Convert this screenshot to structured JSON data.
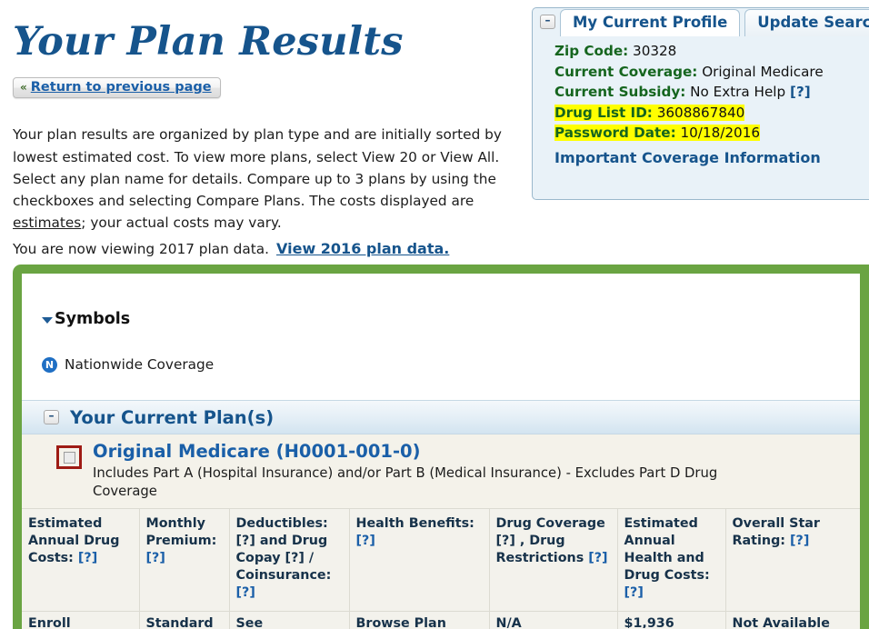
{
  "page_title": "Your Plan Results",
  "return_button": {
    "chevron": "«",
    "label": "Return to previous page"
  },
  "intro": {
    "part1": "Your plan results are organized by plan type and are initially sorted by lowest estimated cost. To view more plans, select View 20 or View All. Select any plan name for details. Compare up to 3 plans by using the checkboxes and selecting Compare Plans. The costs displayed are ",
    "estimates_word": "estimates",
    "part2": "; your actual costs may vary."
  },
  "viewing": {
    "text": "You are now viewing 2017 plan data.",
    "link": "View 2016 plan data."
  },
  "profile": {
    "collapse_symbol": "–",
    "tab_active": "My Current Profile",
    "tab_inactive": "Update Search",
    "rows": [
      {
        "label": "Zip Code:",
        "value": "30328",
        "help": "",
        "highlight": false
      },
      {
        "label": "Current Coverage:",
        "value": "Original Medicare",
        "help": "",
        "highlight": false
      },
      {
        "label": "Current Subsidy:",
        "value": "No Extra Help",
        "help": "[?]",
        "highlight": false
      },
      {
        "label": "Drug List ID:",
        "value": "3608867840",
        "help": "",
        "highlight": true
      },
      {
        "label": "Password Date:",
        "value": "10/18/2016",
        "help": "",
        "highlight": true
      }
    ],
    "coverage_info_link": "Important Coverage Information"
  },
  "symbols": {
    "heading": "Symbols",
    "items": [
      {
        "badge": "N",
        "label": "Nationwide Coverage"
      }
    ]
  },
  "current_plans": {
    "collapse_symbol": "–",
    "title": "Your Current Plan(s)",
    "plan": {
      "name": "Original Medicare (H0001-001-0)",
      "description": "Includes Part A (Hospital Insurance) and/or Part B (Medical Insurance) - Excludes Part D Drug Coverage"
    },
    "columns": [
      {
        "head": "Estimated Annual Drug Costs:",
        "help": "[?]"
      },
      {
        "head": "Monthly Premium:",
        "help": "[?]"
      },
      {
        "head": "Deductibles: [?] and Drug Copay [?] / Coinsurance:",
        "help": "[?]"
      },
      {
        "head": "Health Benefits:",
        "help": "[?]"
      },
      {
        "head": "Drug Coverage [?] , Drug Restrictions",
        "help": "[?]"
      },
      {
        "head": "Estimated Annual Health and Drug Costs:",
        "help": "[?]"
      },
      {
        "head": "Overall Star Rating:",
        "help": "[?]"
      }
    ],
    "row_clipped": [
      "Enroll",
      "Standard",
      "See Personalized",
      "Browse Plan",
      "N/A",
      "$1,936",
      "Not Available"
    ]
  },
  "colors": {
    "title_blue": "#16548c",
    "link_blue": "#1a5fa8",
    "green_border": "#6aa442",
    "label_green": "#15651e",
    "highlight_yellow": "#ffff00",
    "checkbox_red": "#9e1b14"
  }
}
